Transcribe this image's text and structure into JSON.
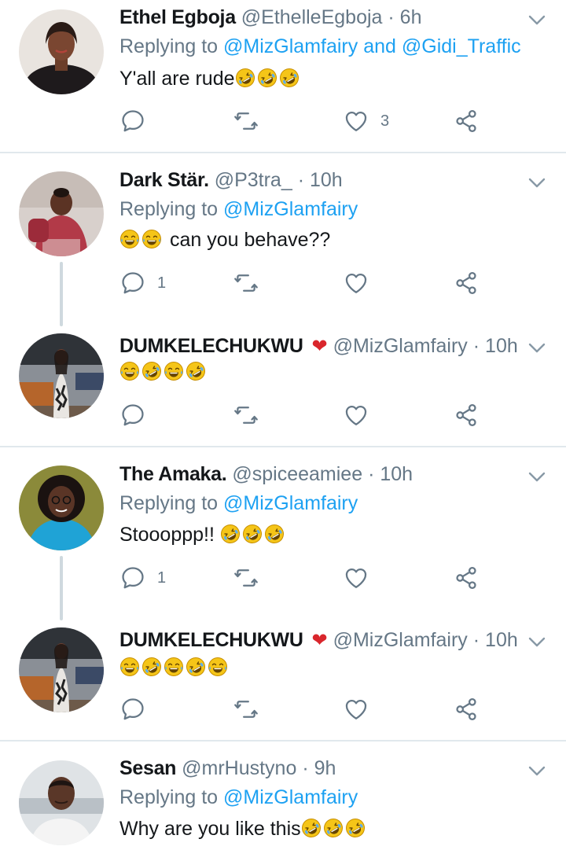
{
  "colors": {
    "accent": "#1da1f2",
    "muted": "#657786",
    "text": "#14171a",
    "heart": "#d9262c",
    "divider": "#e1e8ed"
  },
  "tweets": [
    {
      "name": "Ethel Egboja",
      "handle": "@EthelleEgboja",
      "time": "6h",
      "replying_prefix": "Replying to",
      "mentions": [
        "@MizGlamfairy",
        "@Gidi_Traffic"
      ],
      "mention_joiner": "and",
      "text": "Y'all are rude",
      "emojis": [
        "rofl",
        "rofl",
        "rofl"
      ],
      "reply_count": "",
      "like_count": "3"
    },
    {
      "name": "Dark Stär.",
      "handle": "@P3tra_",
      "time": "10h",
      "replying_prefix": "Replying to",
      "mentions": [
        "@MizGlamfairy"
      ],
      "text": "can you behave??",
      "emojis_before": [
        "joy",
        "joy"
      ],
      "reply_count": "1",
      "like_count": ""
    },
    {
      "name": "DUMKELECHUKWU",
      "name_emoji": "❤",
      "handle": "@MizGlamfairy",
      "time": "10h",
      "emojis": [
        "joy",
        "rofl",
        "joy",
        "rofl"
      ],
      "reply_count": "",
      "like_count": ""
    },
    {
      "name": "The Amaka.",
      "handle": "@spiceeamiee",
      "time": "10h",
      "replying_prefix": "Replying to",
      "mentions": [
        "@MizGlamfairy"
      ],
      "text": "Stoooppp!! ",
      "emojis": [
        "rofl",
        "rofl",
        "rofl"
      ],
      "reply_count": "1",
      "like_count": ""
    },
    {
      "name": "DUMKELECHUKWU",
      "name_emoji": "❤",
      "handle": "@MizGlamfairy",
      "time": "10h",
      "emojis": [
        "joy",
        "rofl",
        "joy",
        "rofl",
        "joy"
      ],
      "reply_count": "",
      "like_count": ""
    },
    {
      "name": "Sesan",
      "handle": "@mrHustyno",
      "time": "9h",
      "replying_prefix": "Replying to",
      "mentions": [
        "@MizGlamfairy"
      ],
      "text": "Why are you like this",
      "emojis": [
        "rofl",
        "rofl",
        "rofl"
      ]
    }
  ],
  "separator": "·",
  "icons": [
    "reply-icon",
    "retweet-icon",
    "like-icon",
    "share-icon",
    "chevron-down-icon",
    "rofl-emoji",
    "joy-emoji"
  ]
}
